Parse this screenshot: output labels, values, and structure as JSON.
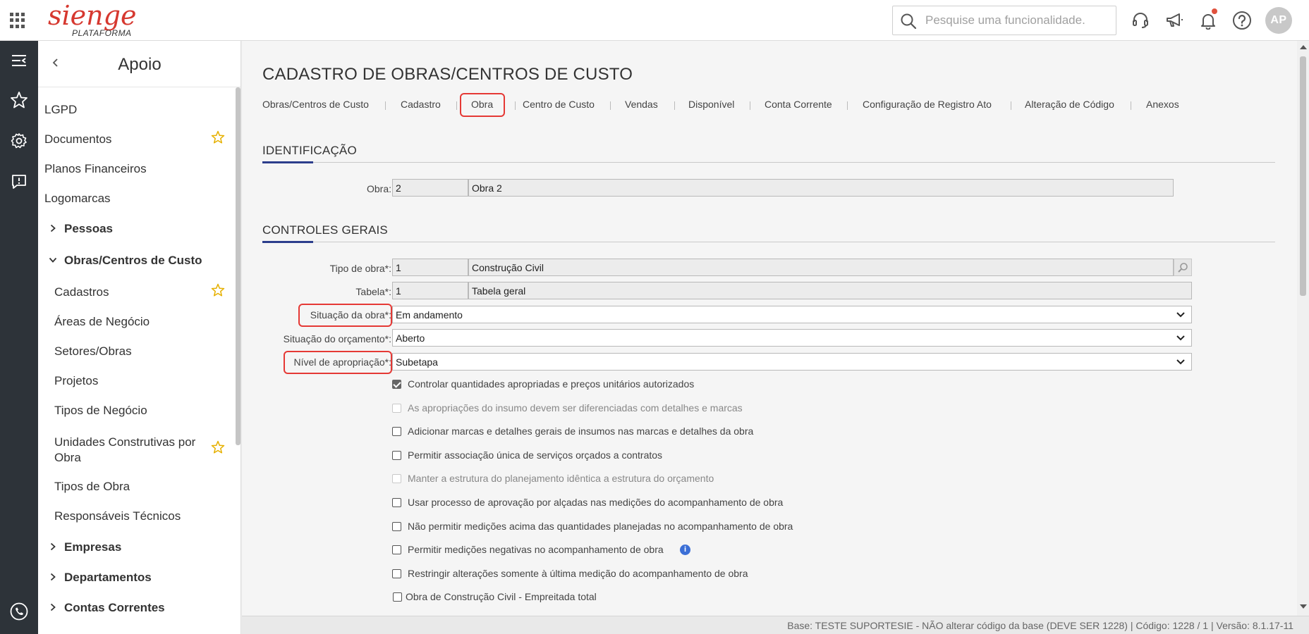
{
  "header": {
    "logo_main": "sienge",
    "logo_sub": "PLATAFORMA",
    "search_placeholder": "Pesquise uma funcionalidade.",
    "avatar_initials": "AP",
    "icons": [
      "apps-grid-icon",
      "search-icon",
      "headset-icon",
      "megaphone-icon",
      "bell-icon",
      "help-icon"
    ],
    "notification_dot_color": "#e0513d"
  },
  "rail": {
    "icons": [
      "menu-collapse-icon",
      "star-icon",
      "gear-icon",
      "chat-icon",
      "phone-icon"
    ]
  },
  "sidebar": {
    "title": "Apoio",
    "items": [
      {
        "label": "LGPD"
      },
      {
        "label": "Documentos",
        "favorite": true
      },
      {
        "label": "Planos Financeiros"
      },
      {
        "label": "Logomarcas"
      },
      {
        "label": "Pessoas",
        "group": true,
        "expanded": false
      },
      {
        "label": "Obras/Centros de Custo",
        "group": true,
        "expanded": true
      },
      {
        "label": "Cadastros",
        "favorite": true
      },
      {
        "label": "Áreas de Negócio"
      },
      {
        "label": "Setores/Obras"
      },
      {
        "label": "Projetos"
      },
      {
        "label": "Tipos de Negócio"
      },
      {
        "label_line1": "Unidades Construtivas por",
        "label_line2": "Obra",
        "favorite": true
      },
      {
        "label": "Tipos de Obra"
      },
      {
        "label": "Responsáveis Técnicos"
      },
      {
        "label": "Empresas",
        "group": true,
        "expanded": false
      },
      {
        "label": "Departamentos",
        "group": true,
        "expanded": false
      },
      {
        "label": "Contas Correntes",
        "group": true,
        "expanded": false
      }
    ]
  },
  "main": {
    "title": "CADASTRO DE OBRAS/CENTROS DE CUSTO",
    "tabs": [
      "Obras/Centros de Custo",
      "Cadastro",
      "Obra",
      "Centro de Custo",
      "Vendas",
      "Disponível",
      "Conta Corrente",
      "Configuração de Registro Ato",
      "Alteração de Código",
      "Anexos"
    ],
    "active_tab": "Obra",
    "highlight_color": "#e53935",
    "accent_color": "#2c3e8c",
    "identificacao": {
      "title": "IDENTIFICAÇÃO",
      "obra_label": "Obra:",
      "obra_code": "2",
      "obra_name": "Obra 2"
    },
    "controles": {
      "title": "CONTROLES GERAIS",
      "tipo_obra_label": "Tipo de obra*:",
      "tipo_obra_code": "1",
      "tipo_obra_name": "Construção Civil",
      "tabela_label": "Tabela*:",
      "tabela_code": "1",
      "tabela_name": "Tabela geral",
      "situacao_obra_label": "Situação da obra*:",
      "situacao_obra_value": "Em andamento",
      "situacao_orcamento_label": "Situação do orçamento*:",
      "situacao_orcamento_value": "Aberto",
      "nivel_label": "Nível de apropriação*:",
      "nivel_value": "Subetapa",
      "checkboxes": [
        {
          "label": "Controlar quantidades apropriadas e preços unitários autorizados",
          "checked": true,
          "disabled": false
        },
        {
          "label": "As apropriações do insumo devem ser diferenciadas com detalhes e marcas",
          "checked": false,
          "disabled": true
        },
        {
          "label": "Adicionar marcas e detalhes gerais de insumos nas marcas e detalhes da obra",
          "checked": false,
          "disabled": false
        },
        {
          "label": "Permitir associação única de serviços orçados a contratos",
          "checked": false,
          "disabled": false
        },
        {
          "label": "Manter a estrutura do planejamento idêntica a estrutura do orçamento",
          "checked": false,
          "disabled": true
        },
        {
          "label": "Usar processo de aprovação por alçadas nas medições do acompanhamento de obra",
          "checked": false,
          "disabled": false
        },
        {
          "label": "Não permitir medições acima das quantidades planejadas no acompanhamento de obra",
          "checked": false,
          "disabled": false
        },
        {
          "label": "Permitir medições negativas no acompanhamento de obra",
          "checked": false,
          "disabled": false,
          "info": "i"
        },
        {
          "label": "Restringir alterações somente à última medição do acompanhamento de obra",
          "checked": false,
          "disabled": false
        },
        {
          "label": "Obra de Construção Civil - Empreitada total",
          "checked": false,
          "disabled": false
        }
      ]
    }
  },
  "status": {
    "text": "Base: TESTE SUPORTESIE - NÃO alterar código da base (DEVE SER 1228) | Código: 1228 / 1 | Versão: 8.1.17-11"
  }
}
